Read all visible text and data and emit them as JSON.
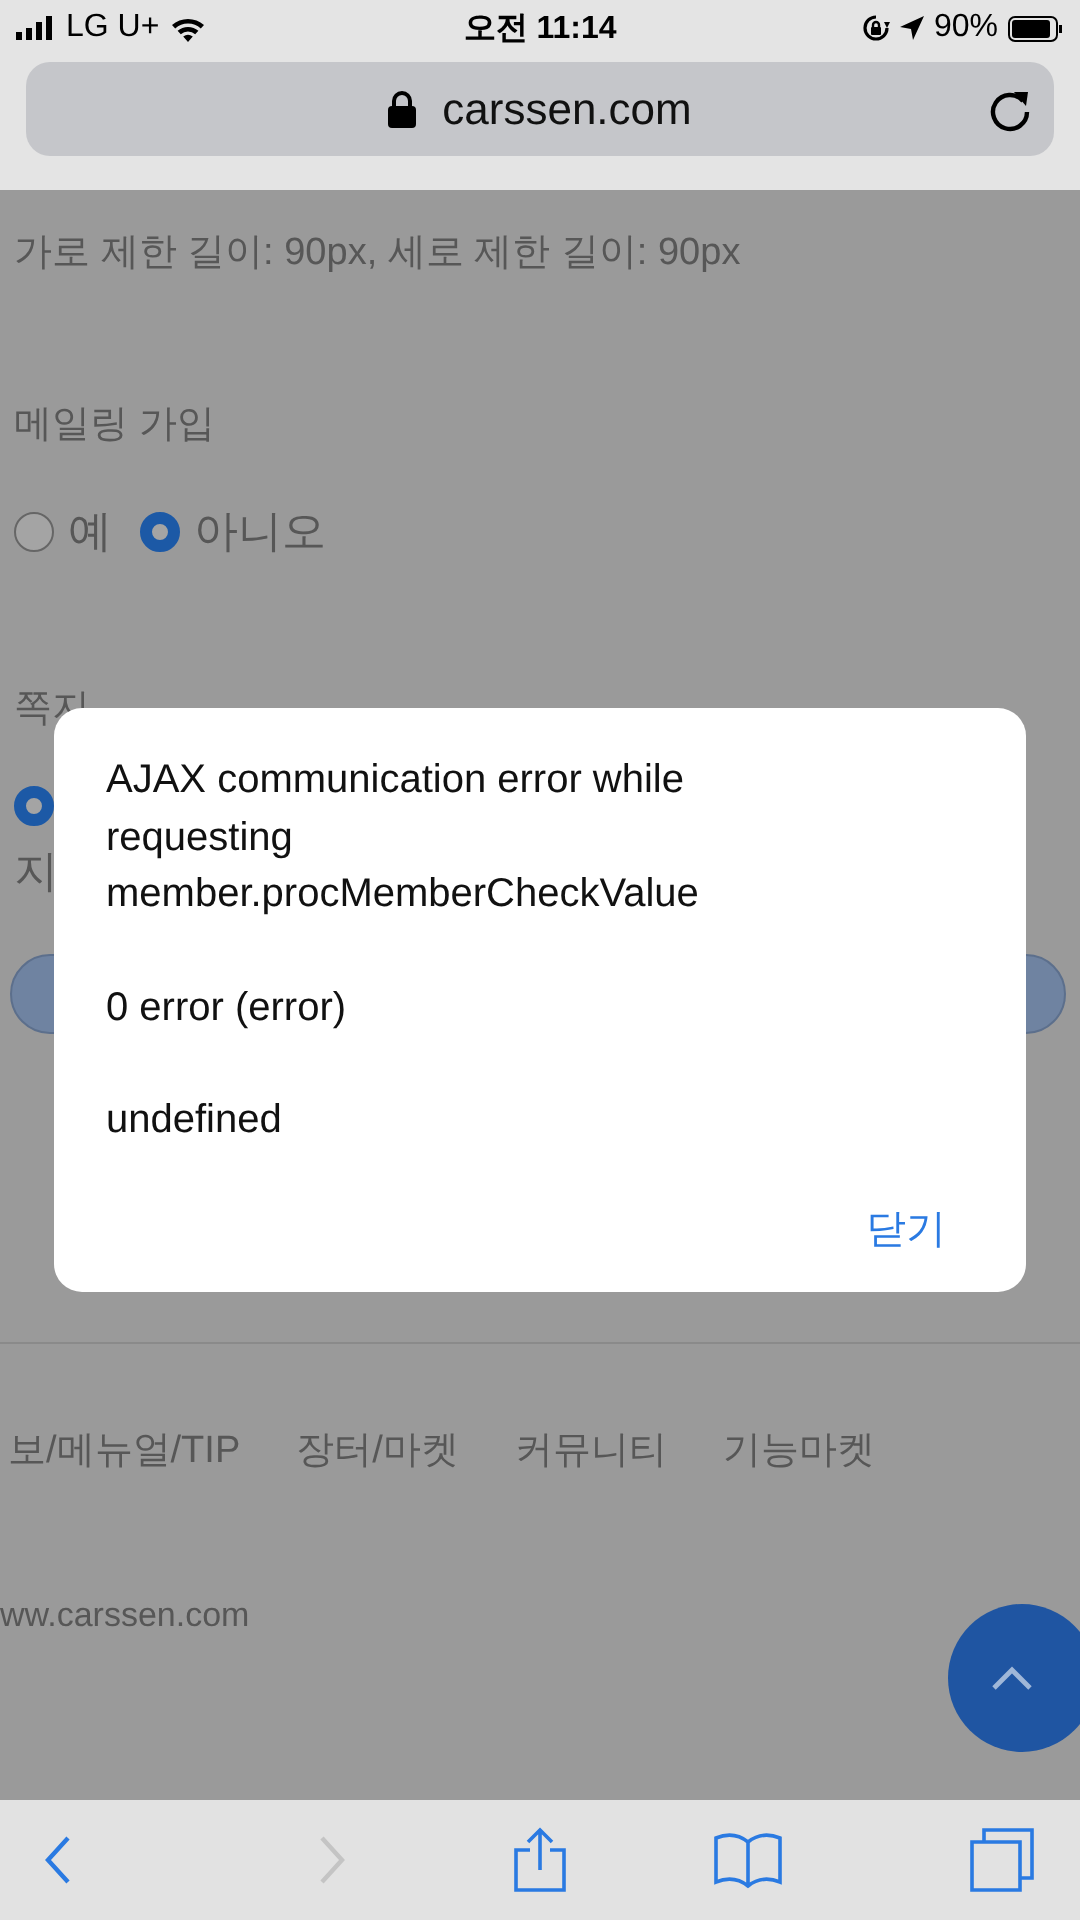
{
  "status_bar": {
    "carrier": "LG U+",
    "time": "오전 11:14",
    "battery": "90%"
  },
  "address_bar": {
    "url": "carssen.com"
  },
  "page": {
    "hint": "가로 제한 길이: 90px, 세로 제한 길이: 90px",
    "groups": [
      {
        "label": "메일링 가입",
        "options": [
          {
            "label": "예",
            "selected": false
          },
          {
            "label": "아니오",
            "selected": true
          }
        ]
      },
      {
        "label": "쪽지",
        "options": [
          {
            "selected": true
          }
        ]
      }
    ],
    "partial_text": "지",
    "footer_links": [
      "보/메뉴얼/TIP",
      "장터/마켓",
      "커뮤니티",
      "기능마켓"
    ],
    "footer_url": "ww.carssen.com"
  },
  "dialog": {
    "paragraphs": [
      "AJAX communication error while requesting member.procMemberCheckValue",
      "0 error (error)",
      "undefined"
    ],
    "button": "닫기"
  },
  "toolbar": [
    {
      "kind": "back",
      "disabled": false
    },
    {
      "kind": "forward",
      "disabled": true
    },
    {
      "kind": "share",
      "disabled": false
    },
    {
      "kind": "bookmarks",
      "disabled": false
    },
    {
      "kind": "tabs",
      "disabled": false
    }
  ]
}
